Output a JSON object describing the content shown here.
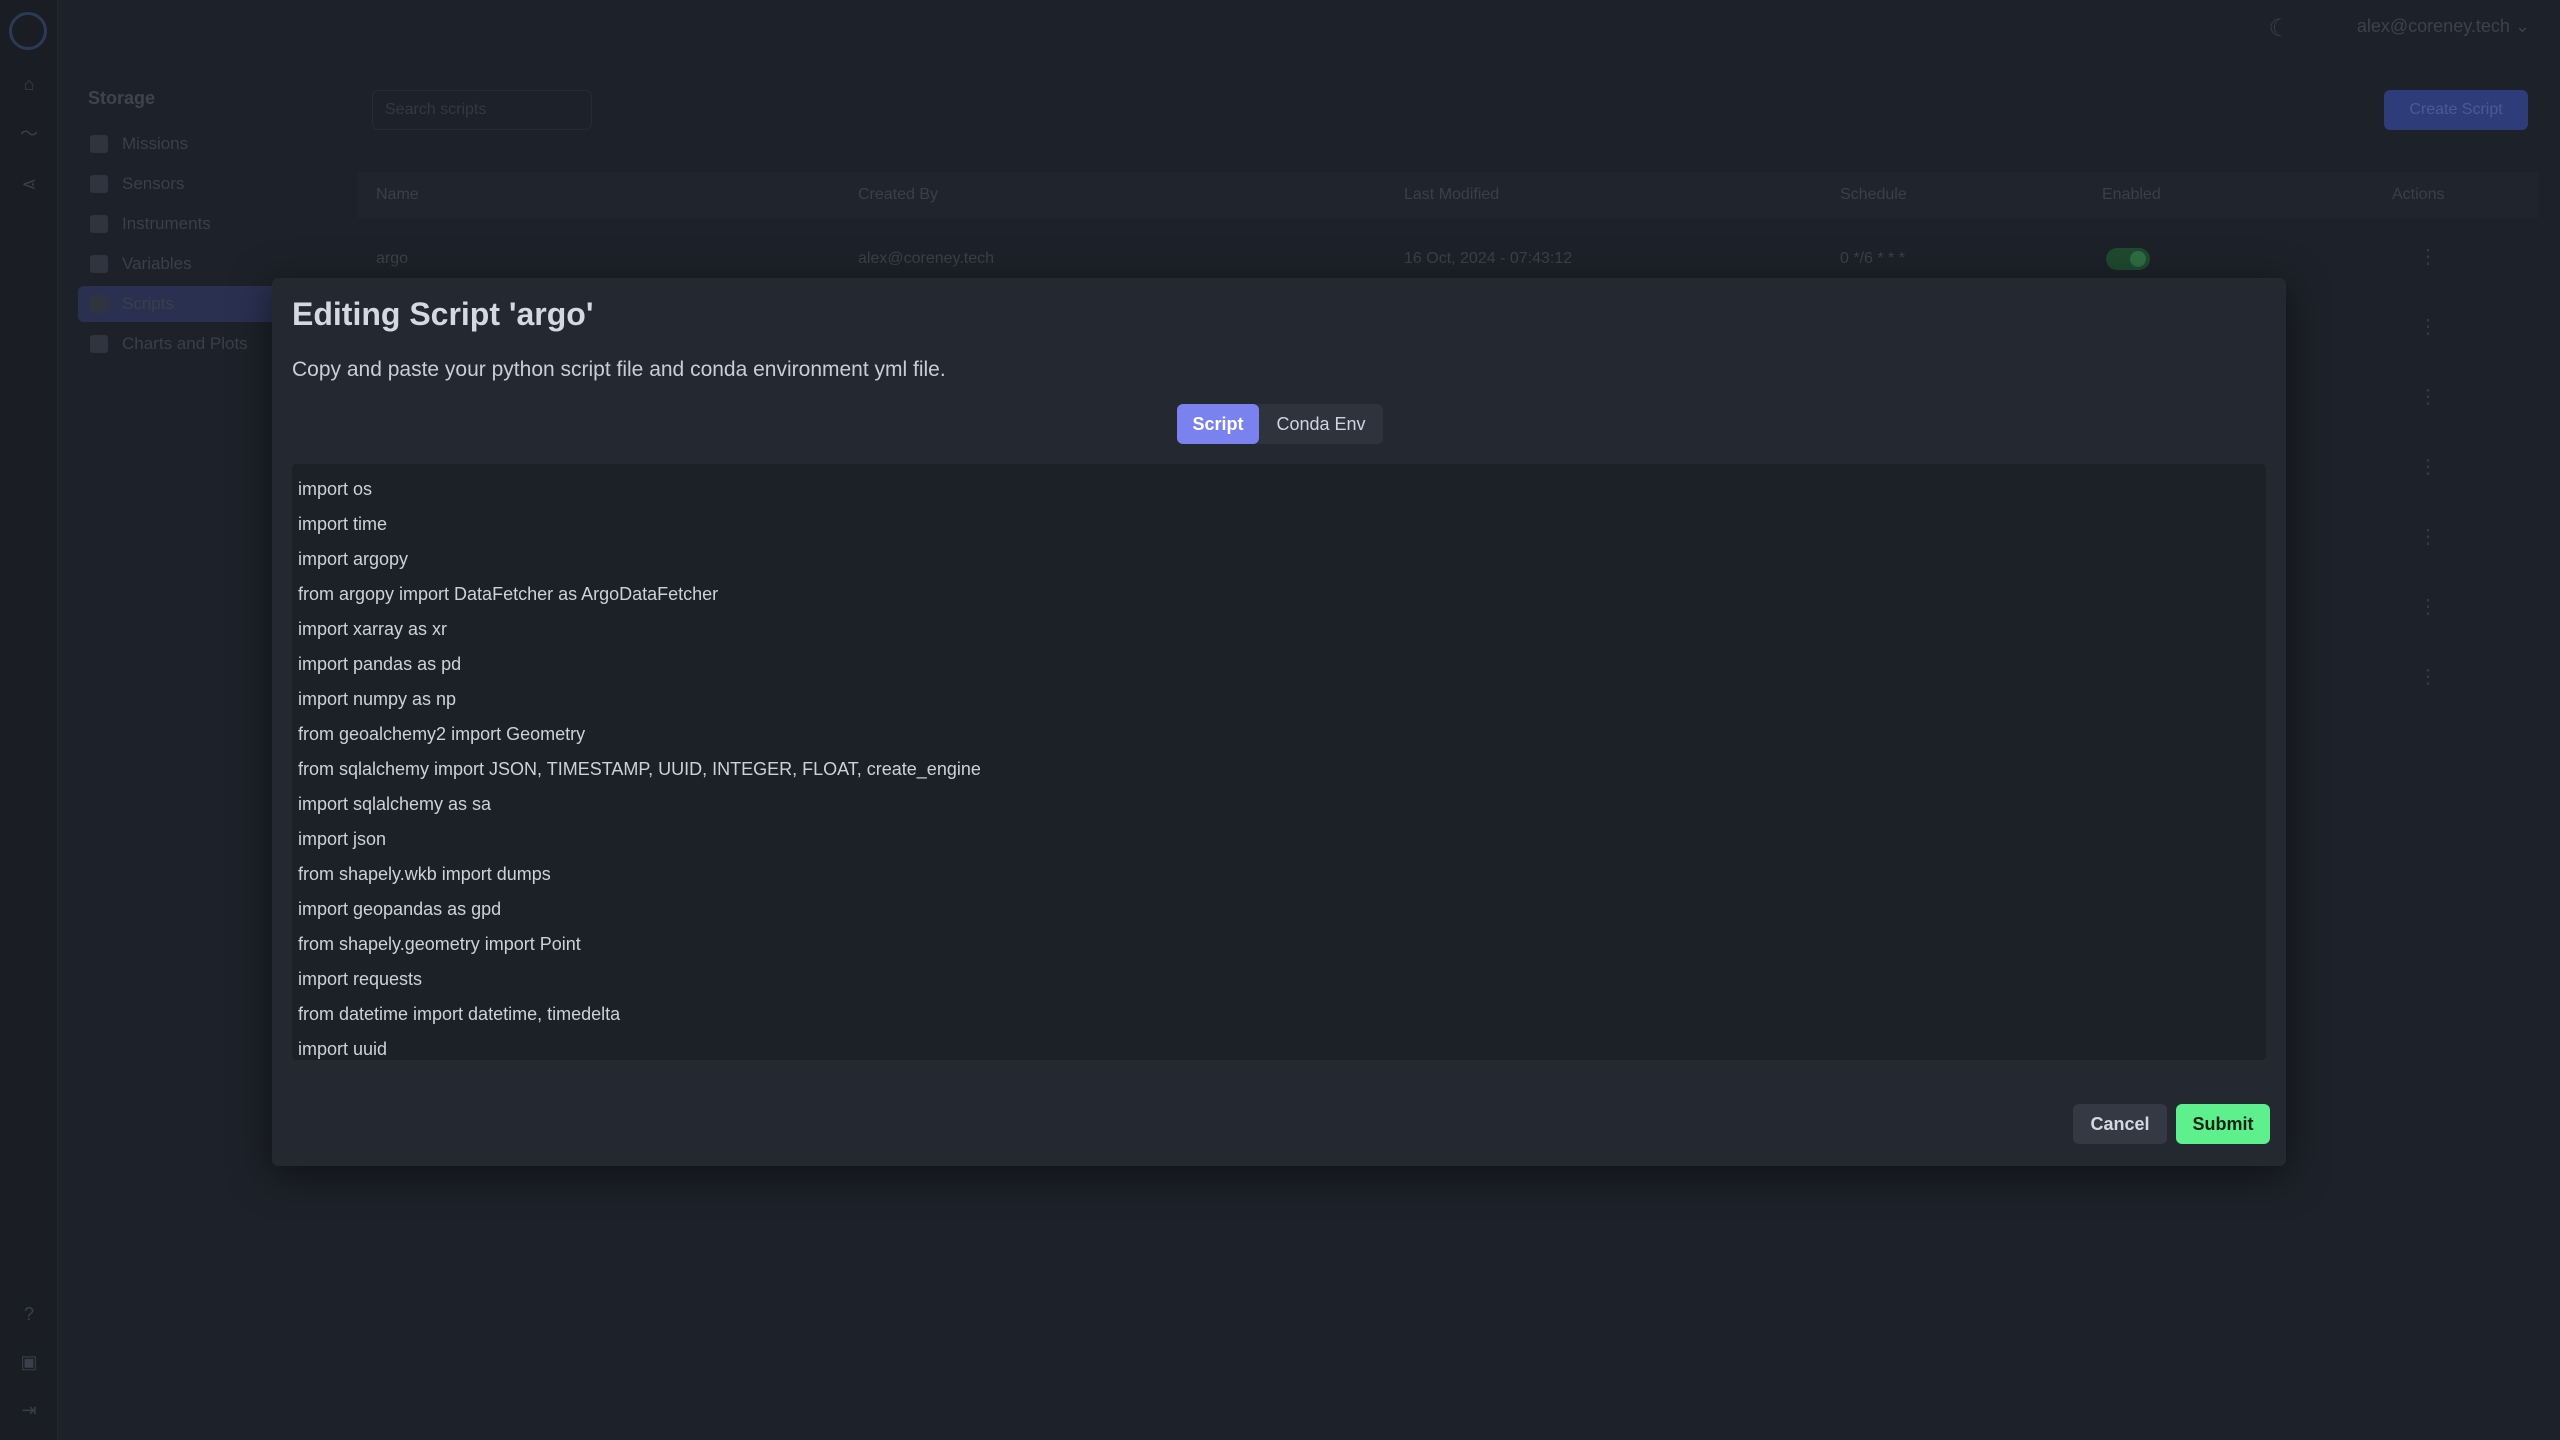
{
  "header": {
    "user_email": "alex@coreney.tech",
    "theme_icon": "moon-icon"
  },
  "sidebar": {
    "section_title": "Storage",
    "items": [
      {
        "label": "Missions",
        "icon": "box-icon"
      },
      {
        "label": "Sensors",
        "icon": "wrench-icon"
      },
      {
        "label": "Instruments",
        "icon": "chart-icon"
      },
      {
        "label": "Variables",
        "icon": "grid-icon"
      },
      {
        "label": "Scripts",
        "icon": "code-icon",
        "active": true
      },
      {
        "label": "Charts and Plots",
        "icon": "line-chart-icon"
      }
    ]
  },
  "toolbar": {
    "search_placeholder": "Search scripts",
    "create_label": "Create Script"
  },
  "table": {
    "columns": [
      "Name",
      "Created By",
      "Last Modified",
      "Schedule",
      "Enabled",
      "Actions"
    ],
    "first_row": {
      "name": "argo",
      "created_by": "alex@coreney.tech",
      "last_modified": "16 Oct, 2024 - 07:43:12",
      "schedule": "0 */6 * * *",
      "enabled": true
    }
  },
  "modal": {
    "title": "Editing Script 'argo'",
    "description": "Copy and paste your python script file and conda environment yml file.",
    "tabs": [
      {
        "label": "Script",
        "active": true
      },
      {
        "label": "Conda Env",
        "active": false
      }
    ],
    "code_lines": [
      "import os",
      "import time",
      "import argopy",
      "from argopy import DataFetcher as ArgoDataFetcher",
      "import xarray as xr",
      "import pandas as pd",
      "import numpy as np",
      "from geoalchemy2 import Geometry",
      "from sqlalchemy import JSON, TIMESTAMP, UUID, INTEGER, FLOAT, create_engine",
      "import sqlalchemy as sa",
      "import json",
      "from shapely.wkb import dumps",
      "import geopandas as gpd",
      "from shapely.geometry import Point",
      "import requests",
      "from datetime import datetime, timedelta",
      "import uuid"
    ],
    "cancel_label": "Cancel",
    "submit_label": "Submit"
  },
  "colors": {
    "accent": "#7a82f0",
    "submit": "#5ef08c",
    "modal_bg": "#242831",
    "editor_bg": "#1c2027"
  }
}
